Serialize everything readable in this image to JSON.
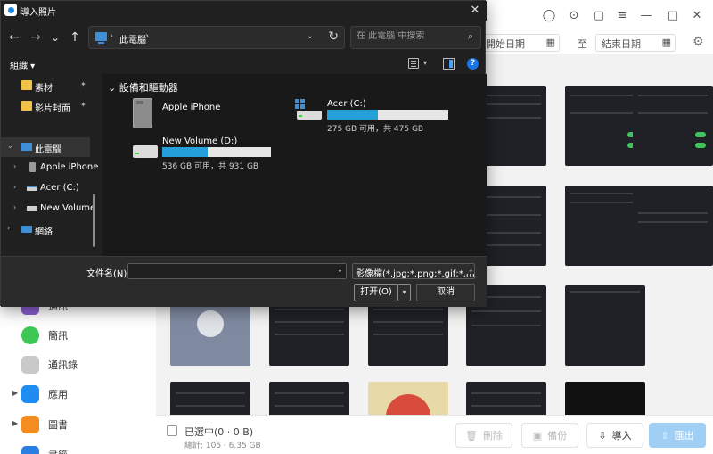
{
  "dialog": {
    "title": "導入照片",
    "nav": {
      "back_icon": "←",
      "forward_icon": "→",
      "recent_icon": "⌄",
      "up_icon": "↑"
    },
    "address": {
      "path": "此電腦",
      "chevron": "›",
      "dropdown_icon": "⌄",
      "refresh_icon": "↻"
    },
    "search": {
      "placeholder": "在 此電腦 中搜索",
      "icon": "⌕"
    },
    "toolbar": {
      "organize_label": "組織 ▾",
      "help_label": "?"
    },
    "nav_pane": {
      "items": [
        {
          "label": "素材",
          "pinned": true
        },
        {
          "label": "影片封面",
          "pinned": true
        },
        {
          "label": "此電腦",
          "selected": true
        },
        {
          "label": "Apple iPhone"
        },
        {
          "label": "Acer (C:)"
        },
        {
          "label": "New Volume"
        },
        {
          "label": "網絡"
        }
      ],
      "arrow_expanded": "⌄",
      "arrow_collapsed": "›",
      "pin_icon": "📌"
    },
    "content": {
      "group_header": "⌄  設備和驅動器",
      "devices": [
        {
          "name": "Apple iPhone",
          "icon": "iphone-icon"
        },
        {
          "name": "Acer (C:)",
          "info": "275 GB 可用，共 475 GB",
          "used_fraction": 0.42,
          "icon": "windows-drive-icon"
        },
        {
          "name": "New Volume (D:)",
          "info": "536 GB 可用，共 931 GB",
          "used_fraction": 0.42,
          "icon": "drive-icon"
        }
      ]
    },
    "bottom": {
      "filename_label": "文件名(N):",
      "filename_value": "",
      "filetype_value": "影像檔(*.jpg;*.png;*.gif;*.mov",
      "open_label": "打开(O)",
      "cancel_label": "取消"
    }
  },
  "background": {
    "filter": {
      "start_date": "開始日期",
      "to_label": "至",
      "end_date": "結束日期"
    },
    "sidebar": [
      {
        "label": "通訊"
      },
      {
        "label": "簡訊"
      },
      {
        "label": "通訊錄"
      },
      {
        "label": "應用"
      },
      {
        "label": "圖書"
      },
      {
        "label": "書籤"
      }
    ],
    "footer": {
      "selected": "已選中(0 · 0 B)",
      "total": "總計: 105 · 6.35 GB",
      "delete_label": "刪除",
      "backup_label": "備份",
      "import_label": "導入",
      "export_label": "匯出"
    }
  }
}
